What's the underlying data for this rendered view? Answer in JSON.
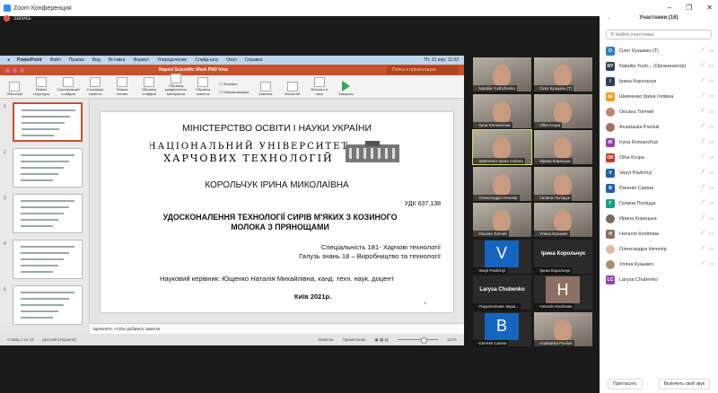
{
  "window": {
    "title": "Zoom Конференция",
    "recording": "Запись",
    "minimize": "–",
    "restore": "❐",
    "close": "✕"
  },
  "mac_menu": [
    "PowerPoint",
    "Файл",
    "Правка",
    "Вид",
    "Вставка",
    "Формат",
    "Упорядочение",
    "Слайд-шоу",
    "Окно",
    "Справка"
  ],
  "mac_clock": "Пт, 21 апр. 11:03",
  "ppt": {
    "doc_title": "Report Scientific Work PhD Irina",
    "search_placeholder": "Поиск в презентации",
    "ribbon": [
      "Обычный",
      "Режим структуры",
      "Сортировщик слайдов",
      "Страницы заметок",
      "Режим чтения",
      "Образец слайдов",
      "Образец раздаточного материала",
      "Образец заметок",
      "Заметки",
      "Масштаб",
      "Вписать в окно",
      "Макросы"
    ],
    "checkboxes": [
      "Линейка",
      "Направляющие"
    ],
    "thumb_numbers": [
      "1",
      "2",
      "3",
      "4",
      "5"
    ],
    "notes_placeholder": "Щелкните, чтобы добавить заметки",
    "status": {
      "slide": "Слайд 1 из 23",
      "lang": "русский (Украина)",
      "notes": "Заметки",
      "comments": "Примечания",
      "zoom": "110%"
    }
  },
  "slide": {
    "ministry": "МІНІСТЕРСТВО ОСВІТИ І НАУКИ УКРАЇНИ",
    "logo_line1": "НАЦІОНАЛЬНИЙ УНІВЕРСИТЕТ",
    "logo_line2": "ХАРЧОВИХ ТЕХНОЛОГІЙ",
    "author": "КОРОЛЬЧУК ІРИНА МИКОЛАЇВНА",
    "udk": "УДК 637.138",
    "topic": "УДОСКОНАЛЕННЯ ТЕХНОЛОГІЇ СИРІВ М'ЯКИХ З КОЗИНОГО МОЛОКА З ПРЯНОЩАМИ",
    "specialty": "Спеціальність 181- Харчові технології",
    "field": "Галузь знань 18 – Виробництво та технології",
    "supervisor": "Науковий керівник: Ющенко Наталія Михайлівна, канд. техн. наук, доцент",
    "city": "Київ 2021р.",
    "page": "1"
  },
  "tiles": [
    {
      "name": "Nataliia Yushchenko",
      "kind": "photo"
    },
    {
      "name": "Олег Кузьман (T)",
      "kind": "photo"
    },
    {
      "name": "Iryna Romanchuk",
      "kind": "photo"
    },
    {
      "name": "Olha Krupa",
      "kind": "photo"
    },
    {
      "name": "Шевченко Ірина Іллівна",
      "kind": "photo",
      "active": true
    },
    {
      "name": "Ирина Корецька",
      "kind": "photo"
    },
    {
      "name": "Олександра Нечипір",
      "kind": "photo"
    },
    {
      "name": "Галина Поліщук",
      "kind": "photo"
    },
    {
      "name": "Оксана Топчий",
      "kind": "photo"
    },
    {
      "name": "Уляна Кузьмич",
      "kind": "photo"
    },
    {
      "name": "Vasyl Pavlichyi",
      "kind": "letter",
      "letter": "V",
      "color": "#1565c0"
    },
    {
      "name": "Ірина Корольчук",
      "kind": "text",
      "big": "Ірина Корольчук"
    },
    {
      "name": "Подключение звука...",
      "kind": "text",
      "big": "Larysa Chubenko"
    },
    {
      "name": "Наталія Коліпова",
      "kind": "letter",
      "letter": "H",
      "color": "#8d7064"
    },
    {
      "name": "Євгенія Сапіна",
      "kind": "letter",
      "letter": "B",
      "color": "#1565c0"
    },
    {
      "name": "Anastasiia Pavliuk",
      "kind": "photo"
    }
  ],
  "participants": {
    "title": "Участники (16)",
    "search_placeholder": "Найти участника",
    "invite": "Пригласить",
    "unmute": "Включить свой звук",
    "list": [
      {
        "name": "Олег Кузьман (T)",
        "initials": "O",
        "color": "#2d7fc1"
      },
      {
        "name": "Nataliia Yush... (Организатор)",
        "initials": "NY",
        "color": "#2f3f55"
      },
      {
        "name": "Ірина Корольчук",
        "initials": "I",
        "color": "#2f3f55"
      },
      {
        "name": "Шевченко Ірина Іллівна",
        "initials": "Ш",
        "color": "#f0a020"
      },
      {
        "name": "Оксана Топчий",
        "initials": "",
        "color": "#b98a70"
      },
      {
        "name": "Anastasiia Pavliuk",
        "initials": "",
        "color": "#a07060"
      },
      {
        "name": "Iryna Romanchuk",
        "initials": "IR",
        "color": "#8e44ad"
      },
      {
        "name": "Olha Krupa",
        "initials": "OK",
        "color": "#c0392b"
      },
      {
        "name": "Vasyl Pavlichyi",
        "initials": "V",
        "color": "#1e5fa8"
      },
      {
        "name": "Євгенія Сапіна",
        "initials": "В",
        "color": "#1e5fa8"
      },
      {
        "name": "Галина Поліщук",
        "initials": "Г",
        "color": "#16a085"
      },
      {
        "name": "Ирина Корецька",
        "initials": "",
        "color": "#7a6a5a"
      },
      {
        "name": "Наталія Коліпова",
        "initials": "Н",
        "color": "#8d6e63"
      },
      {
        "name": "Олександра Нечипір",
        "initials": "",
        "color": "#e8b9a0"
      },
      {
        "name": "Уляна Кузьмич",
        "initials": "",
        "color": "#a89070"
      },
      {
        "name": "Larysa Chubenko",
        "initials": "LC",
        "color": "#8e44ad"
      }
    ]
  }
}
